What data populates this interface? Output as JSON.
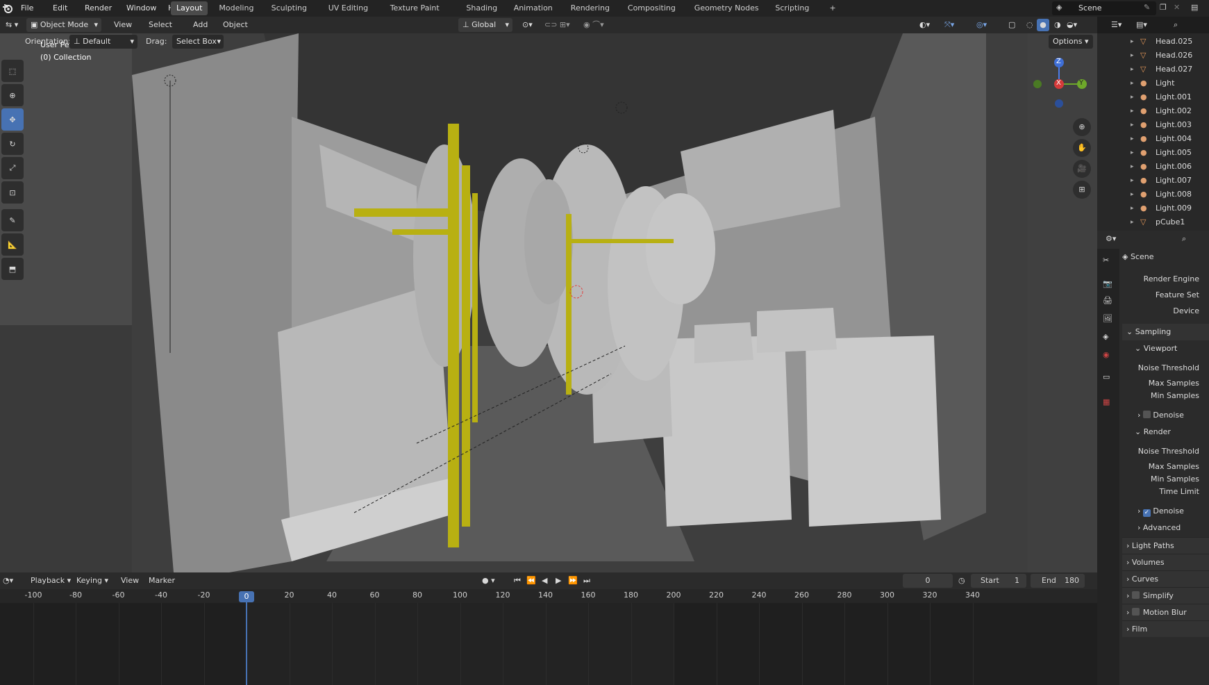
{
  "menus": [
    "File",
    "Edit",
    "Render",
    "Window",
    "Help"
  ],
  "workspaces": [
    "Layout",
    "Modeling",
    "Sculpting",
    "UV Editing",
    "Texture Paint",
    "Shading",
    "Animation",
    "Rendering",
    "Compositing",
    "Geometry Nodes",
    "Scripting"
  ],
  "active_workspace": "Layout",
  "add_workspace": "+",
  "scene_name": "Scene",
  "header": {
    "mode": "Object Mode",
    "menus": [
      "View",
      "Select",
      "Add",
      "Object"
    ],
    "transform": "Global"
  },
  "tool_settings": {
    "orientation_label": "Orientation:",
    "orientation": "Default",
    "drag_label": "Drag:",
    "drag": "Select Box",
    "options": "Options"
  },
  "viewport": {
    "title": "User Perspective",
    "collection": "(0) Collection"
  },
  "gizmo": {
    "x": "X",
    "y": "Y",
    "z": "Z"
  },
  "outliner": [
    {
      "name": "Head.025",
      "type": "mesh"
    },
    {
      "name": "Head.026",
      "type": "mesh"
    },
    {
      "name": "Head.027",
      "type": "mesh"
    },
    {
      "name": "Light",
      "type": "light"
    },
    {
      "name": "Light.001",
      "type": "light"
    },
    {
      "name": "Light.002",
      "type": "light"
    },
    {
      "name": "Light.003",
      "type": "light"
    },
    {
      "name": "Light.004",
      "type": "light"
    },
    {
      "name": "Light.005",
      "type": "light"
    },
    {
      "name": "Light.006",
      "type": "light"
    },
    {
      "name": "Light.007",
      "type": "light"
    },
    {
      "name": "Light.008",
      "type": "light"
    },
    {
      "name": "Light.009",
      "type": "light"
    },
    {
      "name": "pCube1",
      "type": "mesh"
    }
  ],
  "properties": {
    "context": "Scene",
    "fields": {
      "render_engine": "Render Engine",
      "feature_set": "Feature Set",
      "device": "Device"
    },
    "sampling": "Sampling",
    "viewport": "Viewport",
    "render": "Render",
    "noise_threshold": "Noise Threshold",
    "max_samples": "Max Samples",
    "min_samples": "Min Samples",
    "time_limit": "Time Limit",
    "denoise": "Denoise",
    "advanced": "Advanced",
    "panels": [
      {
        "name": "Light Paths",
        "checkbox": false
      },
      {
        "name": "Volumes",
        "checkbox": false
      },
      {
        "name": "Curves",
        "checkbox": false
      },
      {
        "name": "Simplify",
        "checkbox": true
      },
      {
        "name": "Motion Blur",
        "checkbox": true
      },
      {
        "name": "Film",
        "checkbox": false
      }
    ]
  },
  "timeline": {
    "playback": "Playback",
    "keying": "Keying",
    "view": "View",
    "marker": "Marker",
    "current_frame": "0",
    "start_label": "Start",
    "start": "1",
    "end_label": "End",
    "end": "180",
    "ticks": [
      "-100",
      "-80",
      "-60",
      "-40",
      "-20",
      "0",
      "20",
      "40",
      "60",
      "80",
      "100",
      "120",
      "140",
      "160",
      "180",
      "200",
      "220",
      "240",
      "260",
      "280",
      "300",
      "320",
      "340"
    ],
    "playhead": "0"
  }
}
